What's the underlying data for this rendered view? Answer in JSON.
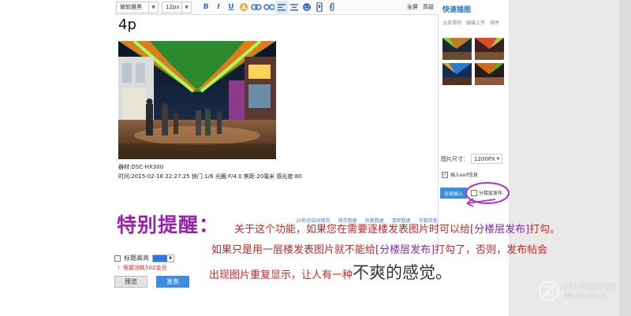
{
  "toolbar": {
    "font_family": "微软雅黑",
    "font_size": "12px",
    "fullscreen_label": "全屏",
    "advanced_label": "高级",
    "icons": [
      "bold-icon",
      "italic-icon",
      "underline-icon",
      "font-color-icon",
      "link-icon",
      "unlink-icon",
      "align-left-icon",
      "align-center-icon",
      "emoji-icon",
      "image-icon",
      "attachment-icon"
    ]
  },
  "post": {
    "title": "4p",
    "exif_camera": "器材:DSC-HX300",
    "exif_detail": "时间:2015-02-18 22:27:25  快门:1/6  光圈:F/4.0  焦距:20毫米  感光度:80"
  },
  "bottom_links": [
    "20秒后自动保存",
    "保存数据",
    "恢复数据",
    "清除数据",
    "字数检查"
  ],
  "side_panel": {
    "title": "快速插图",
    "tabs": [
      "全部清除",
      "缓缓上传",
      "排序"
    ],
    "size_label": "图片尺寸：",
    "size_value": "1200PX",
    "exif_checkbox_label": "插入exif信息",
    "insert_all_label": "全部插入",
    "floor_publish_label": "分楼层发布"
  },
  "options": {
    "highlight_label": "标题高亮",
    "highlight_color": "#2a7de0",
    "cost_note": "！需要消耗50Z金豆",
    "preview_label": "预览",
    "submit_label": "发表"
  },
  "note": {
    "headline": "特别提醒：",
    "line1_text": "关于这个功能，如果您在需要逐楼发表图片时可以给",
    "line1_highlight": "[分楼层发布]",
    "line1_end": "打勾。",
    "line2_text": "如果只是用一层楼发表图片就不能给",
    "line2_highlight": "[分楼层发布]",
    "line2_end": "打勾了，否则，发布帖会",
    "line3_text": "出现图片重复显示，让人有一种",
    "line3_big": "不爽的感觉",
    "line3_end": "。"
  },
  "watermark": {
    "text": "中关村在线论坛",
    "url": "bbs.zol.com.cn"
  }
}
